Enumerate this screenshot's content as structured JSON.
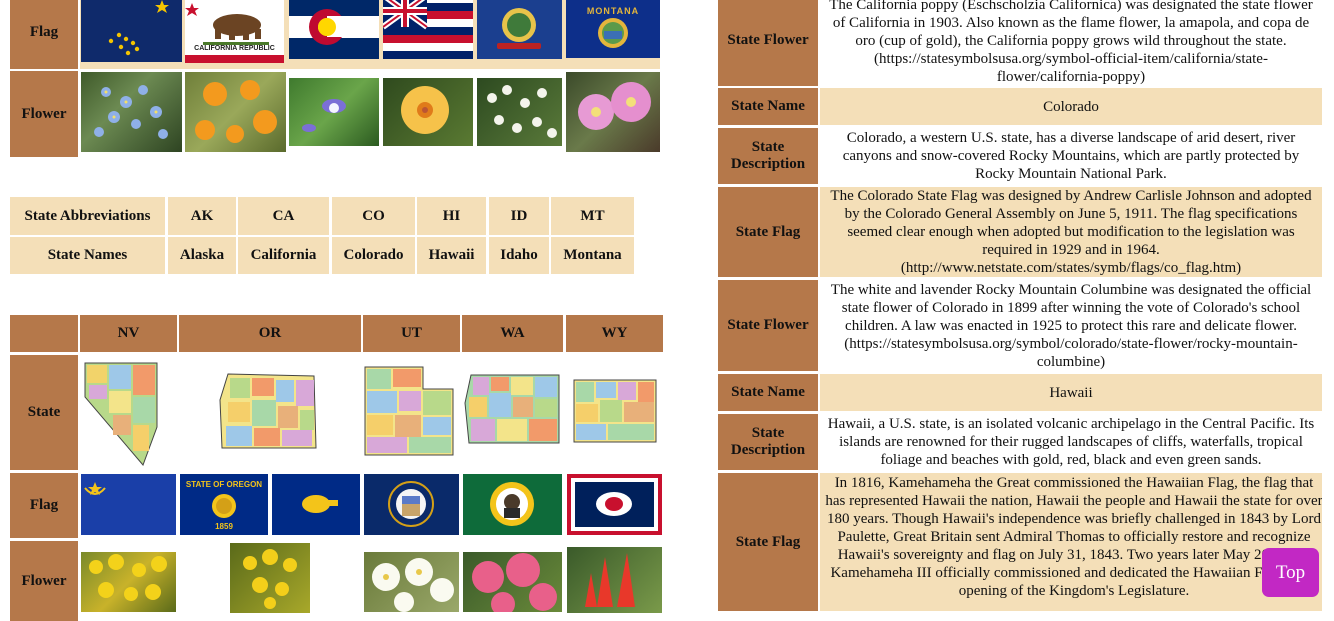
{
  "left": {
    "table1": {
      "row_labels": [
        "Flag",
        "Flower"
      ],
      "flag_icons": [
        "alaska-flag-icon",
        "california-flag-icon",
        "colorado-flag-icon",
        "hawaii-flag-icon",
        "idaho-flag-icon",
        "montana-flag-icon"
      ],
      "california_flag_text": "CALIFORNIA REPUBLIC",
      "montana_flag_text": "MONTANA",
      "flower_images": [
        "forget-me-not-image",
        "california-poppy-image",
        "columbine-image",
        "hibiscus-image",
        "syringa-image",
        "bitterroot-image"
      ]
    },
    "table2": {
      "rows": [
        {
          "label": "State Abbreviations",
          "values": [
            "AK",
            "CA",
            "CO",
            "HI",
            "ID",
            "MT"
          ]
        },
        {
          "label": "State Names",
          "values": [
            "Alaska",
            "California",
            "Colorado",
            "Hawaii",
            "Idaho",
            "Montana"
          ]
        }
      ]
    },
    "table3": {
      "headers": [
        "NV",
        "OR",
        "UT",
        "WA",
        "WY"
      ],
      "row_labels": [
        "State",
        "Flag",
        "Flower"
      ],
      "oregon_flag_text": "STATE OF OREGON",
      "oregon_flag_year": "1859"
    }
  },
  "right": {
    "rows": [
      {
        "label": "State Flower",
        "text": "The California poppy (Eschscholzia Californica) was designated the state flower of California in 1903. Also known as the flame flower, la amapola, and copa de oro (cup of gold), the California poppy grows wild throughout the state. (https://statesymbolsusa.org/symbol-official-item/california/state-flower/california-poppy)"
      },
      {
        "label": "State Name",
        "text": "Colorado"
      },
      {
        "label": "State Description",
        "text": "Colorado, a western U.S. state, has a diverse landscape of arid desert, river canyons and snow-covered Rocky Mountains, which are partly protected by Rocky Mountain National Park."
      },
      {
        "label": "State Flag",
        "text": "The Colorado State Flag was designed by Andrew Carlisle Johnson and adopted by the Colorado General Assembly on June 5, 1911. The flag specifications seemed clear enough when adopted but modification to the legislation was required in 1929 and in 1964. (http://www.netstate.com/states/symb/flags/co_flag.htm)"
      },
      {
        "label": "State Flower",
        "text": "The white and lavender Rocky Mountain Columbine was designated the official state flower of Colorado in 1899 after winning the vote of Colorado's school children. A law was enacted in 1925 to protect this rare and delicate flower. (https://statesymbolsusa.org/symbol/colorado/state-flower/rocky-mountain-columbine)"
      },
      {
        "label": "State Name",
        "text": "Hawaii"
      },
      {
        "label": "State Description",
        "text": "Hawaii, a U.S. state, is an isolated volcanic archipelago in the Central Pacific. Its islands are renowned for their rugged landscapes of cliffs, waterfalls, tropical foliage and beaches with gold, red, black and even green sands."
      },
      {
        "label": "State Flag",
        "text": "In 1816, Kamehameha the Great commissioned the Hawaiian Flag, the flag that has represented Hawaii the nation, Hawaii the people and Hawaii the state for over 180 years. Though Hawaii's independence was briefly challenged in 1843 by Lord Paulette, Great Britain sent Admiral Thomas to officially restore and recognize Hawaii's sovereignty and flag on July 31, 1843. Two years later May 20, 1845, Kamehameha III officially commissioned and dedicated the Hawaiian Flag at the opening of the Kingdom's Legislature."
      }
    ]
  },
  "top_button": {
    "label": "Top"
  },
  "colors": {
    "header_brown": "#b5784a",
    "cell_tan": "#f4dfb8",
    "top_button": "#c228c4"
  }
}
